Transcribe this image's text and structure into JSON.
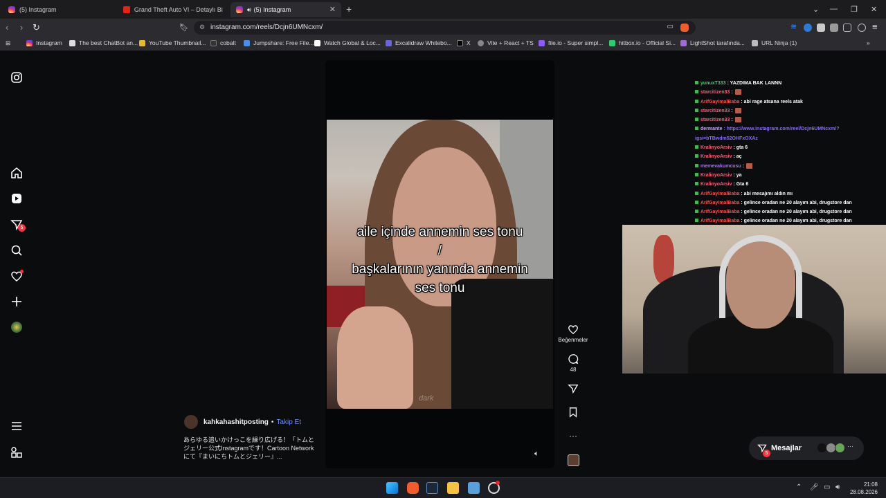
{
  "browser": {
    "tabs": [
      {
        "title": "(5) Instagram",
        "active": false
      },
      {
        "title": "Grand Theft Auto VI – Detaylı Bir Bakı",
        "active": false
      },
      {
        "title": "(5) Instagram",
        "active": true
      }
    ],
    "url": "instagram.com/reels/Dcjn6UMNcxm/",
    "bookmarks": [
      "Instagram",
      "The best ChatBot an...",
      "YouTube Thumbnail...",
      "cobalt",
      "Jumpshare: Free File...",
      "Watch Global & Loc...",
      "Excalidraw Whitebo...",
      "X",
      "Vite + React + TS",
      "file.io - Super simpl...",
      "hitbox.io - Official Si...",
      "LightShot tarafında...",
      "URL Ninja (1)"
    ]
  },
  "sidebar": {
    "icons": [
      "instagram-logo-icon",
      "home-icon",
      "reels-icon",
      "messages-icon",
      "search-icon",
      "notifications-icon",
      "create-icon",
      "profile-avatar",
      "menu-icon",
      "also-from-meta-icon"
    ],
    "messages_badge": "5"
  },
  "reel": {
    "caption_lines": [
      "aile içinde annemin ses tonu",
      "/",
      "başkalarının yanında annemin",
      "ses tonu"
    ],
    "watermark": "dark",
    "author": "kahkahashitposting",
    "separator": "•",
    "follow_label": "Takip Et",
    "description": "あらゆる追いかけっこを繰り広げる！「トムとジェリー公式Instagramです！Cartoon Networkにて『まいにちトムとジェリー』...",
    "likes_label": "Beğenmeler",
    "comments_count": "48"
  },
  "chat": [
    {
      "user": "yunuxT333",
      "msg": ": YAZDIMA BAK LANNN",
      "color": "#3ccf6e"
    },
    {
      "user": "starcitizen33",
      "msg": ":",
      "color": "#ff5a7a",
      "emote": true
    },
    {
      "user": "ArifGayimalBaba",
      "msg": ": abi rage atsana reels atak",
      "color": "#ff4d4d"
    },
    {
      "user": "starcitizen33",
      "msg": ":",
      "color": "#ff5a7a",
      "emote": true
    },
    {
      "user": "starcitizen33",
      "msg": ":",
      "color": "#ff5a7a",
      "emote": true
    },
    {
      "user": "dermante",
      "msg": ": https://www.instagram.com/reel/Dcjn6UMNcxm/?",
      "color": "#c9a6ff",
      "link": true
    },
    {
      "user": "",
      "msg": "igsi=bTBwdm52OHFxOXAz",
      "color": "#c9a6ff",
      "link": true
    },
    {
      "user": "KralinyoArsiv",
      "msg": ": gta 6",
      "color": "#ff5a7a"
    },
    {
      "user": "KralinyoArsiv",
      "msg": ": aç",
      "color": "#ff5a7a"
    },
    {
      "user": "memevakumcusu",
      "msg": ":",
      "color": "#b06cff",
      "emote": true
    },
    {
      "user": "KralinyoArsiv",
      "msg": ": ya",
      "color": "#ff5a7a"
    },
    {
      "user": "KralinyoArsiv",
      "msg": ": Gta 6",
      "color": "#ff5a7a"
    },
    {
      "user": "ArifGayimalBaba",
      "msg": ": abi mesajımı aldın mı",
      "color": "#ff4d4d"
    },
    {
      "user": "ArifGayimalBaba",
      "msg": ": gelince oradan ne 20 alayım abi, drugstore dan",
      "color": "#ff4d4d"
    },
    {
      "user": "ArifGayimalBaba",
      "msg": ": gelince oradan ne 20 alayım abi, drugstore dan",
      "color": "#ff4d4d"
    },
    {
      "user": "ArifGayimalBaba",
      "msg": ": gelince oradan ne 20 alayım abi, drugstore dan",
      "color": "#ff4d4d"
    }
  ],
  "messages_pill": {
    "label": "Mesajlar",
    "badge": "5",
    "more": "···"
  },
  "taskbar": {
    "time": "21:08",
    "date": "28.08.2026"
  }
}
